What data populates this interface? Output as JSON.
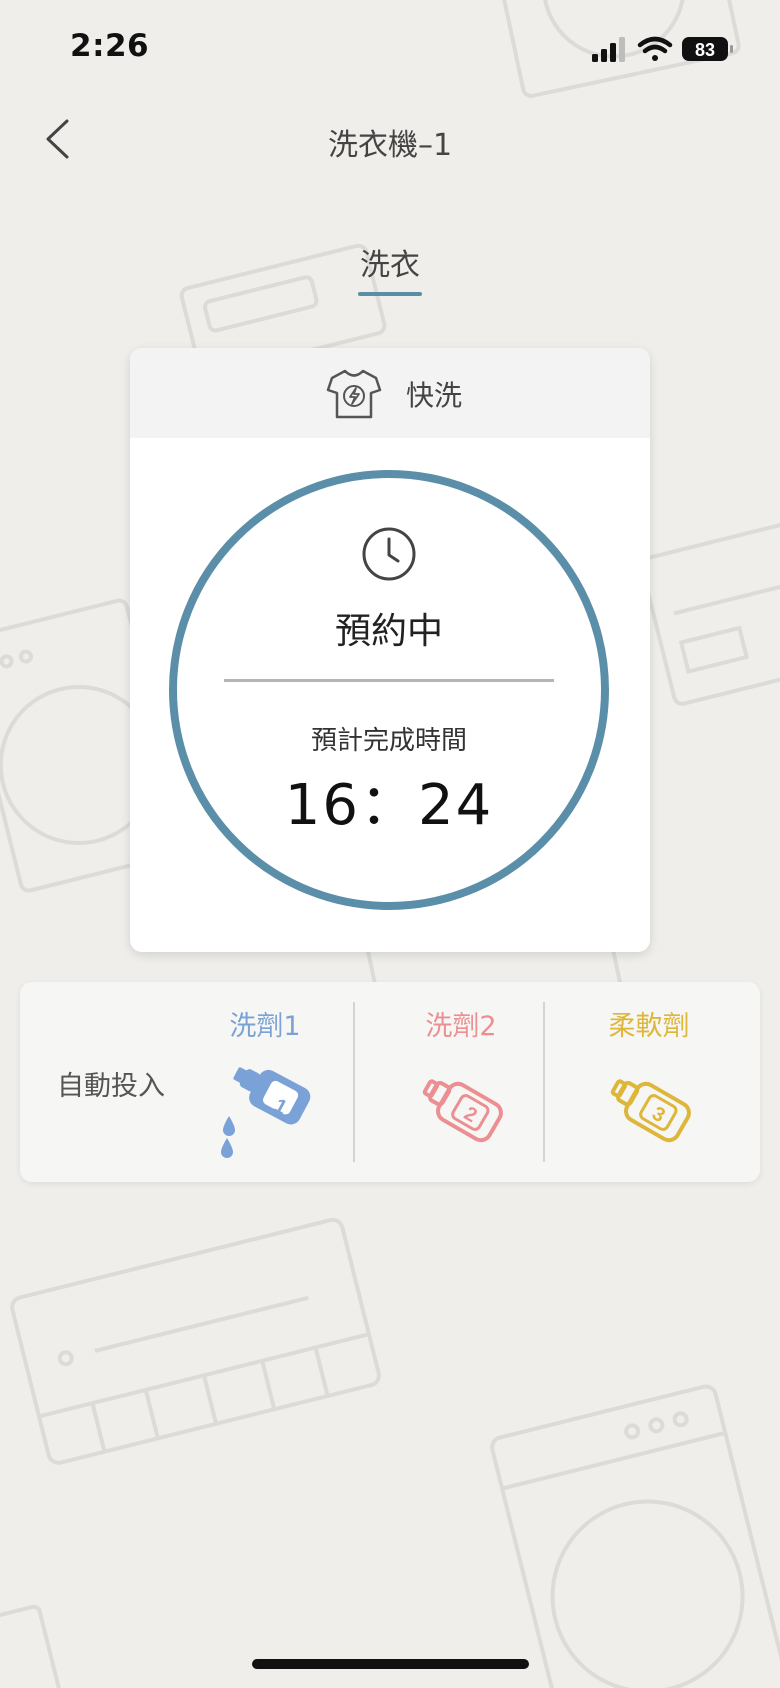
{
  "status_bar": {
    "time": "2:26",
    "battery": "83"
  },
  "nav": {
    "title": "洗衣機–1",
    "back_icon": "chevron-left-icon"
  },
  "tab": {
    "label": "洗衣"
  },
  "card": {
    "mode_icon": "tshirt-lightning-icon",
    "mode_label": "快洗",
    "status_icon": "clock-icon",
    "status": "預約中",
    "finish_label": "預計完成時間",
    "finish_time": "16：24"
  },
  "dispense": {
    "label": "自動投入",
    "slots": [
      {
        "label": "洗劑1",
        "number": "1",
        "color": "#7ba2d6",
        "icon": "detergent-bottle-pouring-icon"
      },
      {
        "label": "洗劑2",
        "number": "2",
        "color": "#ec8f93",
        "icon": "detergent-bottle-icon"
      },
      {
        "label": "柔軟劑",
        "number": "3",
        "color": "#ddb63a",
        "icon": "softener-bottle-icon"
      }
    ]
  },
  "colors": {
    "accent": "#5b8ea8",
    "background": "#efeeea"
  }
}
